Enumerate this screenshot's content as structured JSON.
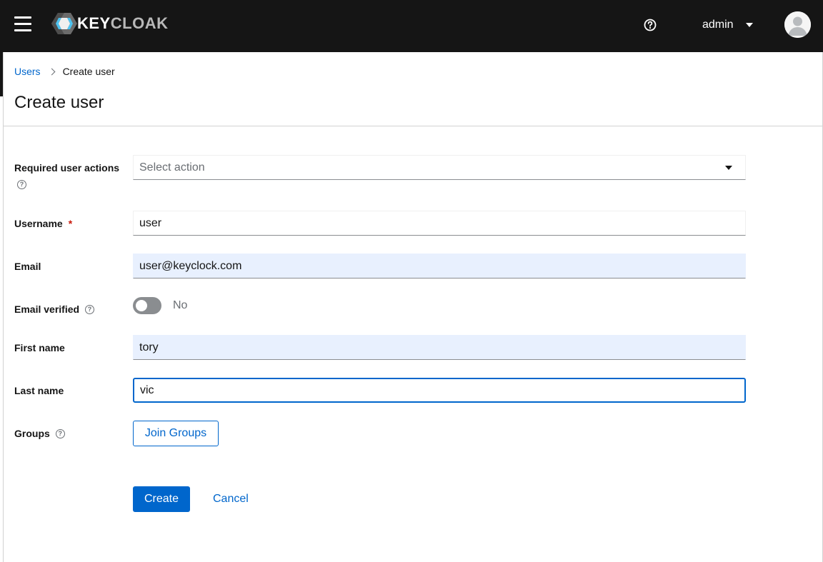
{
  "header": {
    "logo_text_a": "KEY",
    "logo_text_b": "CLOAK",
    "username": "admin",
    "icons": {
      "menu": "hamburger-icon",
      "help": "help-icon",
      "avatar": "user-avatar-icon",
      "dropdown": "caret-down-icon"
    }
  },
  "breadcrumb": {
    "parent": "Users",
    "current": "Create user"
  },
  "page_title": "Create user",
  "form": {
    "required_actions": {
      "label": "Required user actions",
      "placeholder": "Select action"
    },
    "username": {
      "label": "Username",
      "required_mark": "*",
      "value": "user"
    },
    "email": {
      "label": "Email",
      "value": "user@keyclock.com"
    },
    "email_verified": {
      "label": "Email verified",
      "state": "No"
    },
    "first_name": {
      "label": "First name",
      "value": "tory"
    },
    "last_name": {
      "label": "Last name",
      "value": "vic"
    },
    "groups": {
      "label": "Groups",
      "button": "Join Groups"
    }
  },
  "actions": {
    "create": "Create",
    "cancel": "Cancel"
  },
  "colors": {
    "primary": "#0066cc",
    "masthead": "#151515",
    "autofill": "#e8f0fe",
    "required": "#c9190b"
  }
}
